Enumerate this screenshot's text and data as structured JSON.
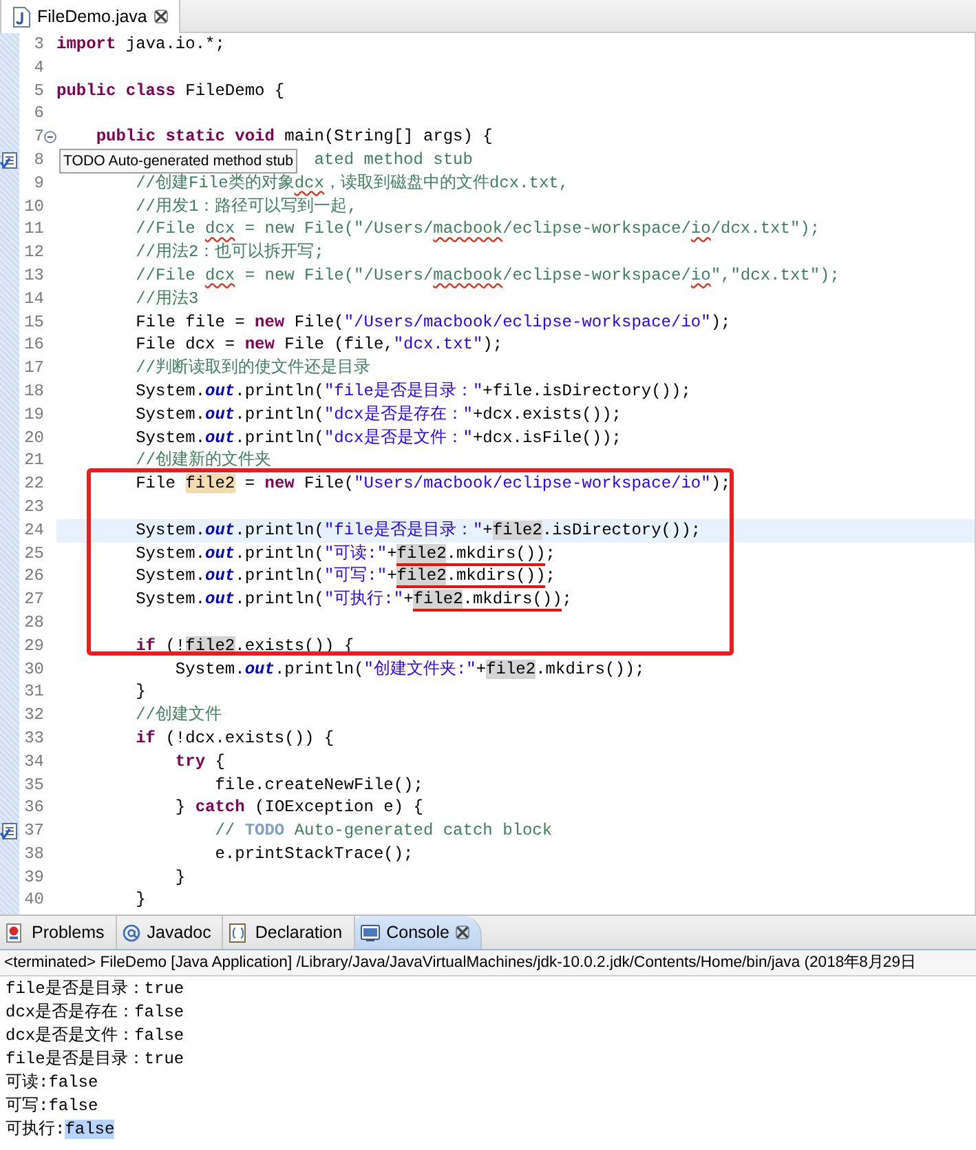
{
  "editor": {
    "tab": {
      "title": "FileDemo.java",
      "selected": true
    },
    "lines": [
      {
        "number": "3",
        "tokens": [
          {
            "t": "import",
            "kind": "kw"
          },
          {
            "t": " java.io.*;",
            "kind": "plain"
          }
        ]
      },
      {
        "number": "4"
      },
      {
        "number": "5",
        "tokens": [
          {
            "t": "public class",
            "kind": "kw"
          },
          {
            "t": " FileDemo {",
            "kind": "plain"
          }
        ]
      },
      {
        "number": "6"
      },
      {
        "number": "7",
        "kind": "fold",
        "tokens": [
          {
            "t": "    public static void",
            "kind": "kw"
          },
          {
            "t": " main(String[] args) {",
            "kind": "plain"
          }
        ]
      },
      {
        "number": "8",
        "kind": "task",
        "tooltip": "TODO Auto-generated method stub",
        "tokens": [
          {
            "t": "                          ated method stub",
            "kind": "cmt"
          }
        ]
      },
      {
        "number": "9",
        "tokens": [
          {
            "t": "        //创建File类的对象",
            "kind": "cmt"
          },
          {
            "t": "dcx",
            "kind": "cmt",
            "misspelled": true
          },
          {
            "t": "，读取到磁盘中的文件dcx.txt,",
            "kind": "cmt"
          }
        ]
      },
      {
        "number": "10",
        "tokens": [
          {
            "t": "        //用发1：路径可以写到一起,",
            "kind": "cmt"
          }
        ]
      },
      {
        "number": "11",
        "tokens": [
          {
            "t": "        //File ",
            "kind": "cmt"
          },
          {
            "t": "dcx",
            "kind": "cmt",
            "misspelled": true
          },
          {
            "t": " = new File(\"/Users/",
            "kind": "cmt"
          },
          {
            "t": "macbook",
            "kind": "cmt",
            "misspelled": true
          },
          {
            "t": "/eclipse-workspace/",
            "kind": "cmt"
          },
          {
            "t": "io",
            "kind": "cmt",
            "misspelled": true
          },
          {
            "t": "/dcx.txt\");",
            "kind": "cmt"
          }
        ]
      },
      {
        "number": "12",
        "tokens": [
          {
            "t": "        //用法2：也可以拆开写;",
            "kind": "cmt"
          }
        ]
      },
      {
        "number": "13",
        "tokens": [
          {
            "t": "        //File ",
            "kind": "cmt"
          },
          {
            "t": "dcx",
            "kind": "cmt",
            "misspelled": true
          },
          {
            "t": " = new File(\"/Users/",
            "kind": "cmt"
          },
          {
            "t": "macbook",
            "kind": "cmt",
            "misspelled": true
          },
          {
            "t": "/eclipse-workspace/",
            "kind": "cmt"
          },
          {
            "t": "io",
            "kind": "cmt",
            "misspelled": true
          },
          {
            "t": "\",\"dcx.txt\");",
            "kind": "cmt"
          }
        ]
      },
      {
        "number": "14",
        "tokens": [
          {
            "t": "        //用法3",
            "kind": "cmt"
          }
        ]
      },
      {
        "number": "15",
        "tokens": [
          {
            "t": "        File file = ",
            "kind": "plain"
          },
          {
            "t": "new",
            "kind": "kw"
          },
          {
            "t": " File(",
            "kind": "plain"
          },
          {
            "t": "\"/Users/macbook/eclipse-workspace/io\"",
            "kind": "str"
          },
          {
            "t": ");",
            "kind": "plain"
          }
        ]
      },
      {
        "number": "16",
        "tokens": [
          {
            "t": "        File dcx = ",
            "kind": "plain"
          },
          {
            "t": "new",
            "kind": "kw"
          },
          {
            "t": " File (file,",
            "kind": "plain"
          },
          {
            "t": "\"dcx.txt\"",
            "kind": "str"
          },
          {
            "t": ");",
            "kind": "plain"
          }
        ]
      },
      {
        "number": "17",
        "tokens": [
          {
            "t": "        //判断读取到的使文件还是目录",
            "kind": "cmt"
          }
        ]
      },
      {
        "number": "18",
        "tokens": [
          {
            "t": "        System.",
            "kind": "plain"
          },
          {
            "t": "out",
            "kind": "field"
          },
          {
            "t": ".println(",
            "kind": "plain"
          },
          {
            "t": "\"file是否是目录：\"",
            "kind": "str"
          },
          {
            "t": "+file.isDirectory());",
            "kind": "plain"
          }
        ]
      },
      {
        "number": "19",
        "tokens": [
          {
            "t": "        System.",
            "kind": "plain"
          },
          {
            "t": "out",
            "kind": "field"
          },
          {
            "t": ".println(",
            "kind": "plain"
          },
          {
            "t": "\"dcx是否是存在：\"",
            "kind": "str"
          },
          {
            "t": "+dcx.exists());",
            "kind": "plain"
          }
        ]
      },
      {
        "number": "20",
        "tokens": [
          {
            "t": "        System.",
            "kind": "plain"
          },
          {
            "t": "out",
            "kind": "field"
          },
          {
            "t": ".println(",
            "kind": "plain"
          },
          {
            "t": "\"dcx是否是文件：\"",
            "kind": "str"
          },
          {
            "t": "+dcx.isFile());",
            "kind": "plain"
          }
        ]
      },
      {
        "number": "21",
        "tokens": [
          {
            "t": "        //创建新的文件夹",
            "kind": "cmt"
          }
        ]
      },
      {
        "number": "22",
        "tokens": [
          {
            "t": "        File ",
            "kind": "plain"
          },
          {
            "t": "file2",
            "kind": "write"
          },
          {
            "t": " = ",
            "kind": "plain"
          },
          {
            "t": "new",
            "kind": "kw"
          },
          {
            "t": " File(",
            "kind": "plain"
          },
          {
            "t": "\"Users/macbook/eclipse-workspace/io\"",
            "kind": "str"
          },
          {
            "t": ");",
            "kind": "plain"
          }
        ]
      },
      {
        "number": "23"
      },
      {
        "number": "24",
        "current": true,
        "tokens": [
          {
            "t": "        System.",
            "kind": "plain"
          },
          {
            "t": "out",
            "kind": "field"
          },
          {
            "t": ".println(",
            "kind": "plain"
          },
          {
            "t": "\"file是否是目录：\"",
            "kind": "str"
          },
          {
            "t": "+",
            "kind": "plain"
          },
          {
            "t": "file2",
            "kind": "occ"
          },
          {
            "t": ".isDirectory());",
            "kind": "plain"
          }
        ]
      },
      {
        "number": "25",
        "current": false,
        "tokens": [
          {
            "t": "        System.",
            "kind": "plain"
          },
          {
            "t": "out",
            "kind": "field"
          },
          {
            "t": ".println(",
            "kind": "plain"
          },
          {
            "t": "\"可读:\"",
            "kind": "str"
          },
          {
            "t": "+",
            "kind": "plain"
          },
          {
            "t": "file2",
            "kind": "occ",
            "red_underline": true
          },
          {
            "t": ".mkdirs())",
            "kind": "plain",
            "red_underline": true
          },
          {
            "t": ";",
            "kind": "plain"
          }
        ]
      },
      {
        "number": "26",
        "current": false,
        "tokens": [
          {
            "t": "        System.",
            "kind": "plain"
          },
          {
            "t": "out",
            "kind": "field"
          },
          {
            "t": ".println(",
            "kind": "plain"
          },
          {
            "t": "\"可写:\"",
            "kind": "str"
          },
          {
            "t": "+",
            "kind": "plain"
          },
          {
            "t": "file2",
            "kind": "occ",
            "red_underline": true
          },
          {
            "t": ".mkdirs())",
            "kind": "plain",
            "red_underline": true
          },
          {
            "t": ";",
            "kind": "plain"
          }
        ]
      },
      {
        "number": "27",
        "current": false,
        "tokens": [
          {
            "t": "        System.",
            "kind": "plain"
          },
          {
            "t": "out",
            "kind": "field"
          },
          {
            "t": ".println(",
            "kind": "plain"
          },
          {
            "t": "\"可执行:\"",
            "kind": "str"
          },
          {
            "t": "+",
            "kind": "plain"
          },
          {
            "t": "file2",
            "kind": "occ",
            "red_underline": true
          },
          {
            "t": ".mkdirs())",
            "kind": "plain",
            "red_underline": true
          },
          {
            "t": ";",
            "kind": "plain"
          }
        ]
      },
      {
        "number": "28"
      },
      {
        "number": "29",
        "tokens": [
          {
            "t": "        if",
            "kind": "kw"
          },
          {
            "t": " (!",
            "kind": "plain"
          },
          {
            "t": "file2",
            "kind": "occ"
          },
          {
            "t": ".exists()) {",
            "kind": "plain"
          }
        ]
      },
      {
        "number": "30",
        "tokens": [
          {
            "t": "            System.",
            "kind": "plain"
          },
          {
            "t": "out",
            "kind": "field"
          },
          {
            "t": ".println(",
            "kind": "plain"
          },
          {
            "t": "\"创建文件夹:\"",
            "kind": "str"
          },
          {
            "t": "+",
            "kind": "plain"
          },
          {
            "t": "file2",
            "kind": "occ"
          },
          {
            "t": ".mkdirs());",
            "kind": "plain"
          }
        ]
      },
      {
        "number": "31",
        "tokens": [
          {
            "t": "        }",
            "kind": "plain"
          }
        ]
      },
      {
        "number": "32",
        "tokens": [
          {
            "t": "        //创建文件",
            "kind": "cmt"
          }
        ]
      },
      {
        "number": "33",
        "tokens": [
          {
            "t": "        if",
            "kind": "kw"
          },
          {
            "t": " (!dcx.exists()) {",
            "kind": "plain"
          }
        ]
      },
      {
        "number": "34",
        "tokens": [
          {
            "t": "            try",
            "kind": "kw"
          },
          {
            "t": " {",
            "kind": "plain"
          }
        ]
      },
      {
        "number": "35",
        "tokens": [
          {
            "t": "                file.createNewFile();",
            "kind": "plain"
          }
        ]
      },
      {
        "number": "36",
        "tokens": [
          {
            "t": "            } ",
            "kind": "plain"
          },
          {
            "t": "catch",
            "kind": "kw"
          },
          {
            "t": " (IOException e) {",
            "kind": "plain"
          }
        ]
      },
      {
        "number": "37",
        "kind": "task",
        "tokens": [
          {
            "t": "                // ",
            "kind": "cmt"
          },
          {
            "t": "TODO",
            "kind": "todo"
          },
          {
            "t": " Auto-generated catch block",
            "kind": "cmt"
          }
        ]
      },
      {
        "number": "38",
        "tokens": [
          {
            "t": "                e.printStackTrace();",
            "kind": "plain"
          }
        ]
      },
      {
        "number": "39",
        "tokens": [
          {
            "t": "            }",
            "kind": "plain"
          }
        ]
      },
      {
        "number": "40",
        "tokens": [
          {
            "t": "        }",
            "kind": "plain"
          }
        ]
      }
    ]
  },
  "panel": {
    "tabs": [
      {
        "label": "Problems",
        "kind": "problems",
        "selected": false
      },
      {
        "label": "Javadoc",
        "kind": "javadoc",
        "selected": false
      },
      {
        "label": "Declaration",
        "kind": "declaration",
        "selected": false
      },
      {
        "label": "Console",
        "kind": "console",
        "selected": true
      }
    ],
    "console_header": "<terminated> FileDemo [Java Application] /Library/Java/JavaVirtualMachines/jdk-10.0.2.jdk/Contents/Home/bin/java (2018年8月29日",
    "lines": [
      {
        "segments": [
          {
            "t": "file是否是目录：true",
            "selected": false
          }
        ]
      },
      {
        "segments": [
          {
            "t": "dcx是否是存在：false",
            "selected": false
          }
        ]
      },
      {
        "segments": [
          {
            "t": "dcx是否是文件：false",
            "selected": false
          }
        ]
      },
      {
        "segments": [
          {
            "t": "file是否是目录：true",
            "selected": false
          }
        ]
      },
      {
        "segments": [
          {
            "t": "可读:false",
            "selected": false
          }
        ]
      },
      {
        "segments": [
          {
            "t": "可写:false",
            "selected": false
          }
        ]
      },
      {
        "segments": [
          {
            "t": "可执行:",
            "selected": false
          },
          {
            "t": "false",
            "selected": true
          }
        ]
      }
    ]
  }
}
